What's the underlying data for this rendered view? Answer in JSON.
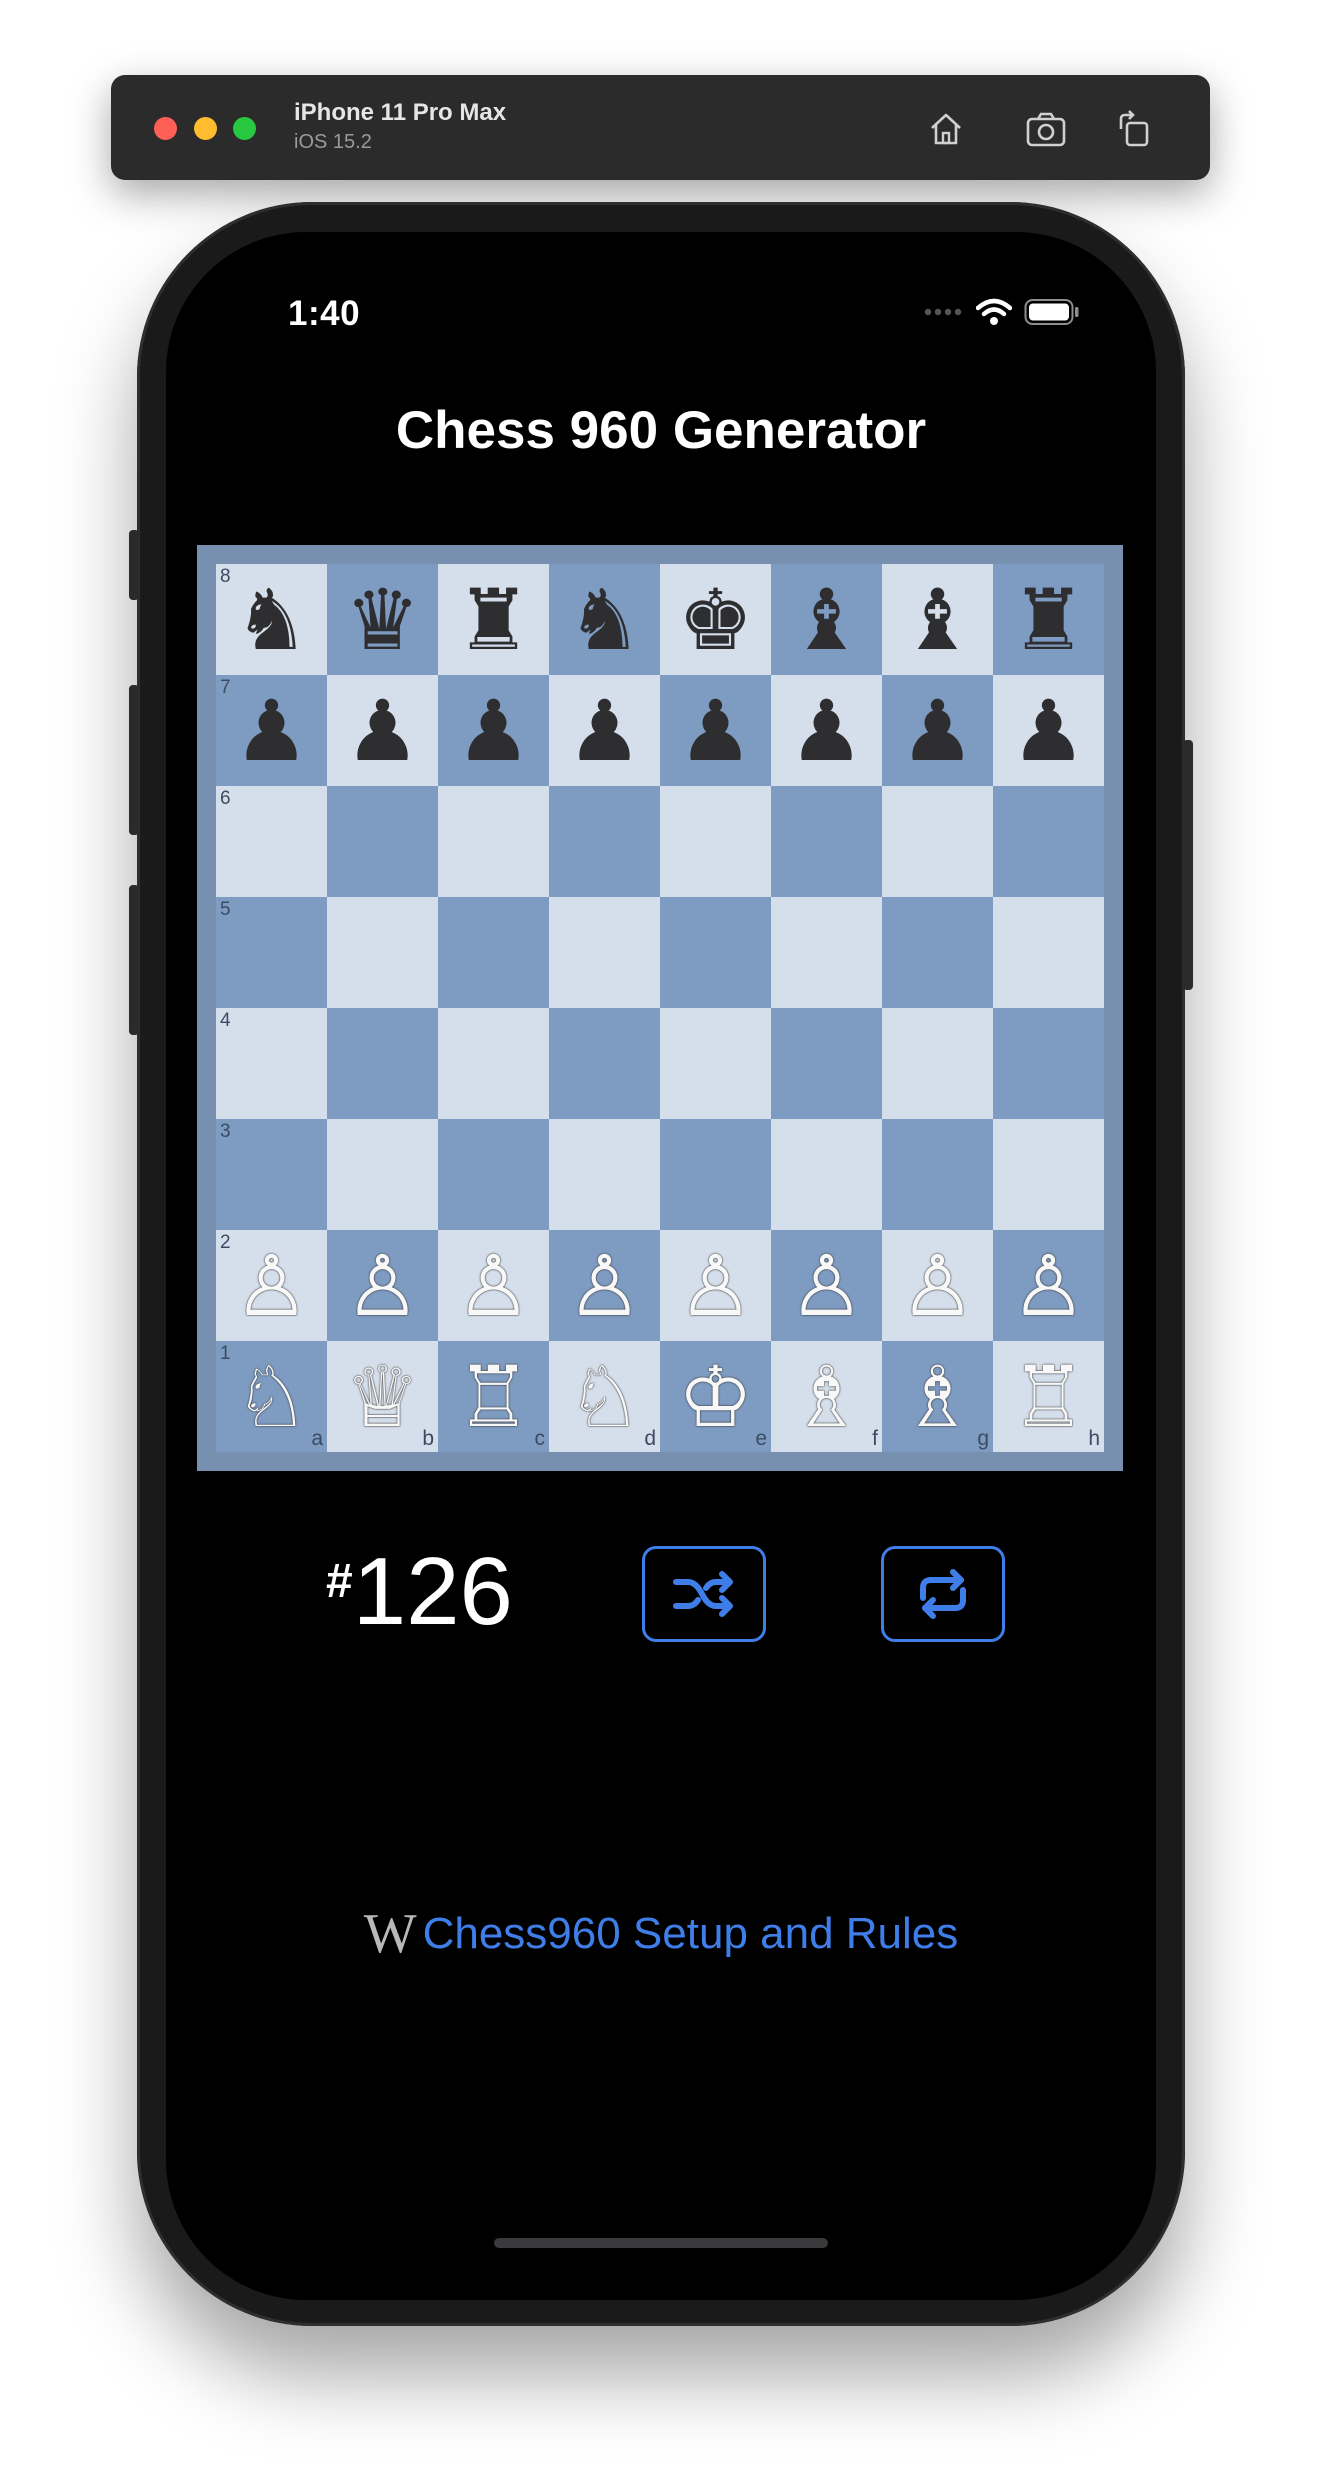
{
  "simulator": {
    "device_name": "iPhone 11 Pro Max",
    "os_version": "iOS 15.2",
    "buttons": [
      "home-icon",
      "camera-icon",
      "rotate-icon"
    ]
  },
  "status_bar": {
    "time": "1:40",
    "icons": [
      "signal-dots-icon",
      "wifi-icon",
      "battery-icon"
    ]
  },
  "app": {
    "title": "Chess 960 Generator",
    "position_hash": "#",
    "position_number": "126",
    "shuffle_button_icon": "shuffle-icon",
    "repeat_button_icon": "repeat-icon",
    "link_logo": "W",
    "link_text": "Chess960 Setup and Rules"
  },
  "board": {
    "files": [
      "a",
      "b",
      "c",
      "d",
      "e",
      "f",
      "g",
      "h"
    ],
    "ranks": [
      "8",
      "7",
      "6",
      "5",
      "4",
      "3",
      "2",
      "1"
    ],
    "back_rank": [
      "N",
      "Q",
      "R",
      "N",
      "K",
      "B",
      "B",
      "R"
    ],
    "rows": [
      [
        "bN",
        "bQ",
        "bR",
        "bN",
        "bK",
        "bB",
        "bB",
        "bR"
      ],
      [
        "bP",
        "bP",
        "bP",
        "bP",
        "bP",
        "bP",
        "bP",
        "bP"
      ],
      [
        "",
        "",
        "",
        "",
        "",
        "",
        "",
        ""
      ],
      [
        "",
        "",
        "",
        "",
        "",
        "",
        "",
        ""
      ],
      [
        "",
        "",
        "",
        "",
        "",
        "",
        "",
        ""
      ],
      [
        "",
        "",
        "",
        "",
        "",
        "",
        "",
        ""
      ],
      [
        "wP",
        "wP",
        "wP",
        "wP",
        "wP",
        "wP",
        "wP",
        "wP"
      ],
      [
        "wN",
        "wQ",
        "wR",
        "wN",
        "wK",
        "wB",
        "wB",
        "wR"
      ]
    ],
    "colors": {
      "light": "#d5dfeb",
      "dark": "#7e9bc1",
      "frame": "#7890b0"
    }
  },
  "colors": {
    "accent": "#3f7ee8",
    "background": "#000000",
    "text": "#ffffff"
  }
}
